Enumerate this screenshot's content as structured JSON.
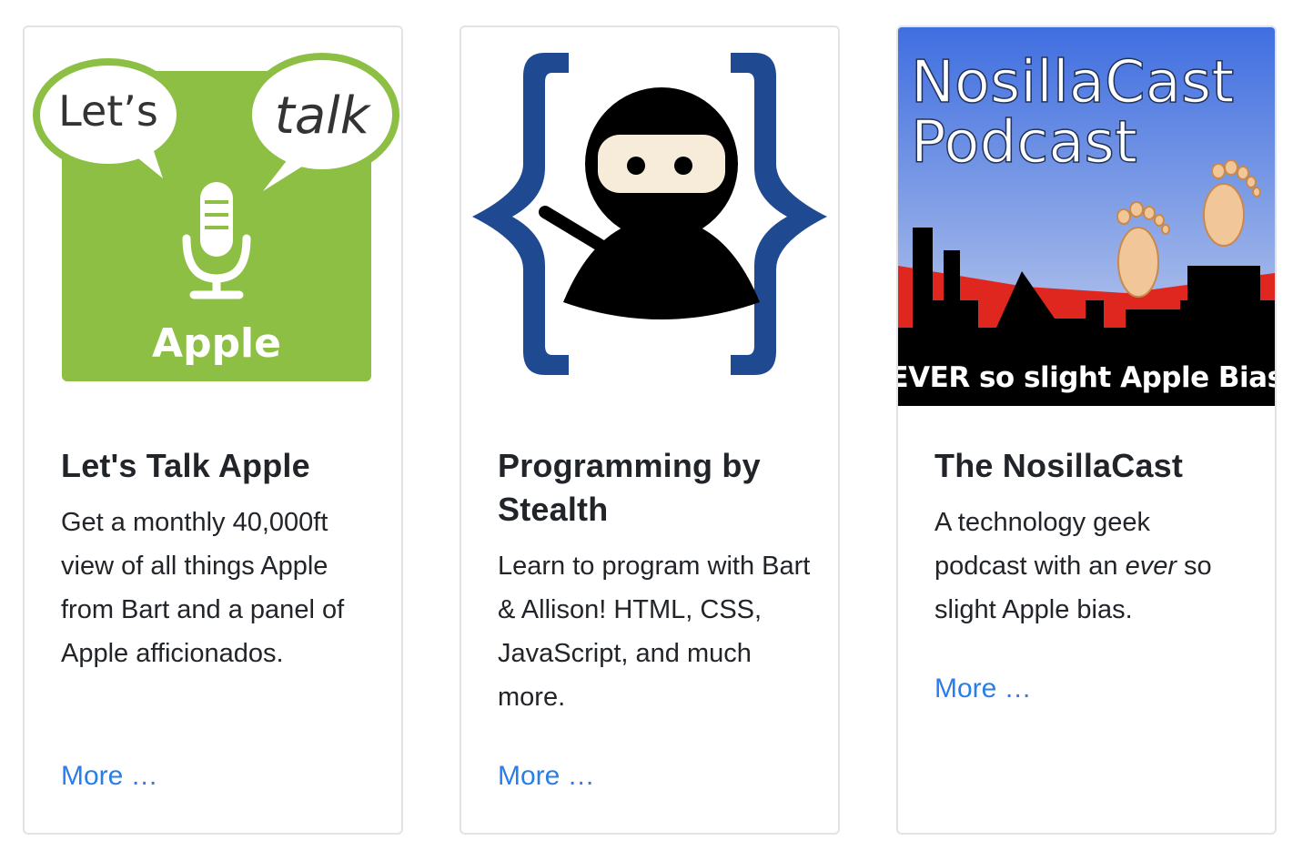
{
  "cards": [
    {
      "image": {
        "alt": "Let's Talk Apple logo",
        "bubble_left": "Let’s",
        "bubble_right": "talk",
        "caption": "Apple",
        "icon": "microphone-icon",
        "colors": {
          "green": "#8cbf43",
          "bubble_border": "#8cbf43"
        }
      },
      "title": "Let's Talk Apple",
      "text": "Get a monthly 40,000ft view of all things Apple from Bart and a panel of Apple afficionados.",
      "link_label": "More …"
    },
    {
      "image": {
        "alt": "Programming by Stealth ninja logo",
        "icon": "ninja-braces-icon",
        "colors": {
          "brace": "#1f4a92",
          "ninja": "#000000",
          "face": "#f7ecd9"
        }
      },
      "title": "Programming by Stealth",
      "text": "Learn to program with Bart & Allison! HTML, CSS, JavaScript, and much more.",
      "link_label": "More …"
    },
    {
      "image": {
        "alt": "NosillaCast Podcast artwork",
        "line1": "NosillaCast",
        "line2": "Podcast",
        "tagline": "EVER so slight Apple Bias",
        "icon": "footprints-icon",
        "colors": {
          "sky_top": "#3f6ee0",
          "sky_bottom": "#c9d4ee",
          "red": "#e0271f",
          "skyline": "#000000"
        }
      },
      "title": "The NosillaCast",
      "text_before": "A technology geek podcast with an ",
      "text_em": "ever",
      "text_after": " so slight Apple bias.",
      "link_label": "More …"
    }
  ],
  "colors": {
    "link": "#2b7de9",
    "card_border": "#e1e3e6",
    "text": "#212529"
  }
}
